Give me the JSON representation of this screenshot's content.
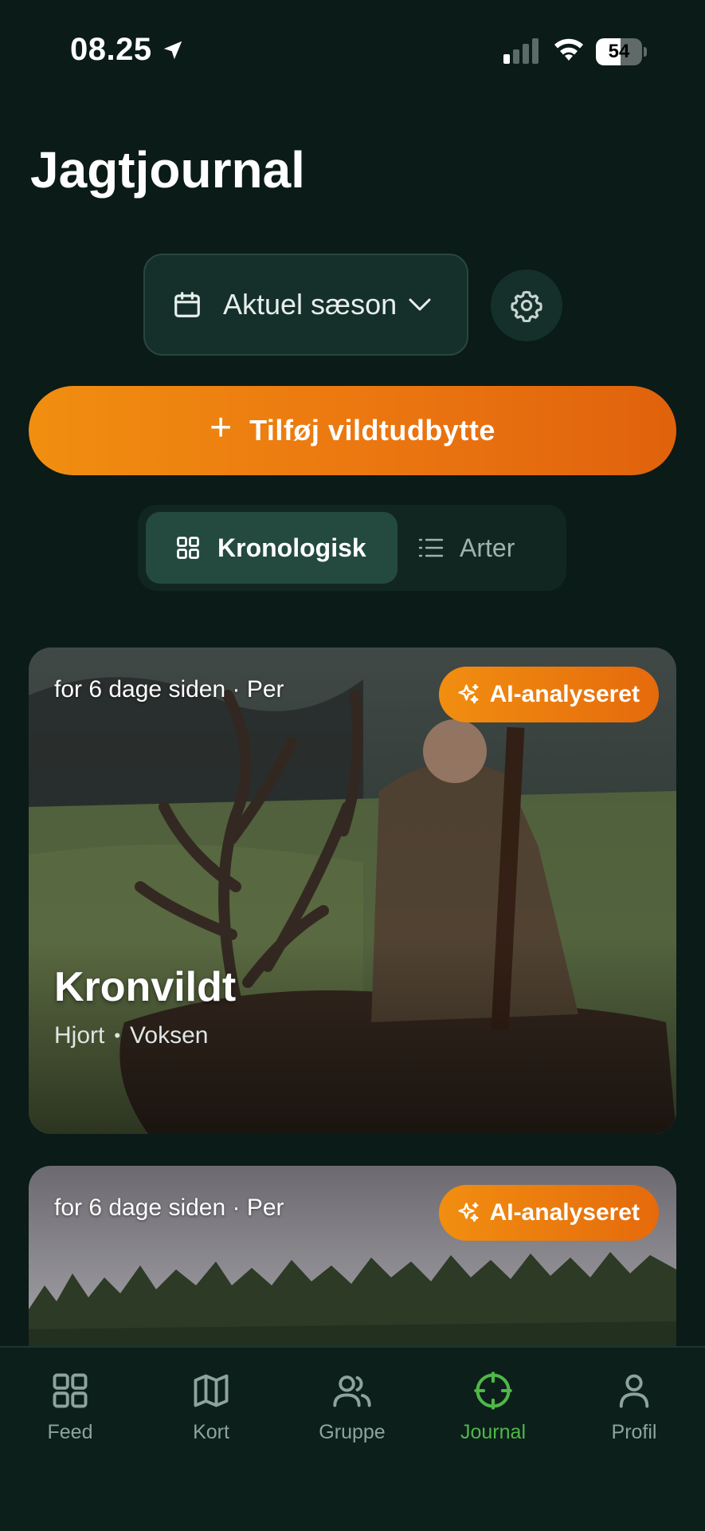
{
  "status_bar": {
    "time": "08.25",
    "battery": "54",
    "battery_level": 0.54
  },
  "header": {
    "title": "Jagtjournal"
  },
  "filters": {
    "season_label": "Aktuel sæson"
  },
  "add_button": {
    "label": "Tilføj vildtudbytte"
  },
  "view_toggle": {
    "active_label": "Kronologisk",
    "inactive_label": "Arter"
  },
  "cards": [
    {
      "meta": "for 6 dage siden · Per",
      "badge": "AI-analyseret",
      "title": "Kronvildt",
      "sub_1": "Hjort",
      "sub_sep": "•",
      "sub_2": "Voksen"
    },
    {
      "meta": "for 6 dage siden · Per",
      "badge": "AI-analyseret"
    }
  ],
  "tab_bar": {
    "items": [
      {
        "label": "Feed",
        "icon": "grid-icon"
      },
      {
        "label": "Kort",
        "icon": "map-icon"
      },
      {
        "label": "Gruppe",
        "icon": "users-icon"
      },
      {
        "label": "Journal",
        "icon": "crosshair-icon"
      },
      {
        "label": "Profil",
        "icon": "user-icon"
      }
    ],
    "active_index": 3,
    "active_color": "#4fb848"
  },
  "colors": {
    "background": "#0b1b17",
    "accent_orange": "#f18e10"
  }
}
